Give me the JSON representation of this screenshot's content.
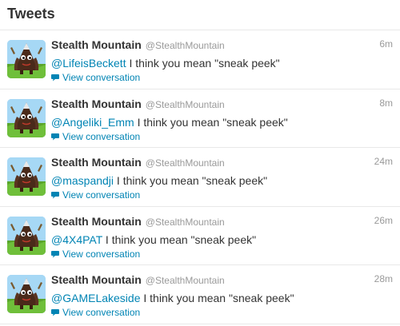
{
  "header": {
    "title": "Tweets"
  },
  "colors": {
    "link": "#0084b4",
    "muted": "#999999",
    "text": "#333333",
    "divider": "#e8e8e8"
  },
  "tweets": [
    {
      "fullname": "Stealth Mountain",
      "username": "@StealthMountain",
      "time": "6m",
      "mention": "@LifeisBeckett",
      "text": " I think you mean \"sneak peek\"",
      "details_label": "View conversation",
      "avatar_icon": "stealth-mountain-avatar"
    },
    {
      "fullname": "Stealth Mountain",
      "username": "@StealthMountain",
      "time": "8m",
      "mention": "@Angeliki_Emm",
      "text": " I think you mean \"sneak peek\"",
      "details_label": "View conversation",
      "avatar_icon": "stealth-mountain-avatar"
    },
    {
      "fullname": "Stealth Mountain",
      "username": "@StealthMountain",
      "time": "24m",
      "mention": "@maspandji",
      "text": " I think you mean \"sneak peek\"",
      "details_label": "View conversation",
      "avatar_icon": "stealth-mountain-avatar"
    },
    {
      "fullname": "Stealth Mountain",
      "username": "@StealthMountain",
      "time": "26m",
      "mention": "@4X4PAT",
      "text": " I think you mean \"sneak peek\"",
      "details_label": "View conversation",
      "avatar_icon": "stealth-mountain-avatar"
    },
    {
      "fullname": "Stealth Mountain",
      "username": "@StealthMountain",
      "time": "28m",
      "mention": "@GAMELakeside",
      "text": " I think you mean \"sneak peek\"",
      "details_label": "View conversation",
      "avatar_icon": "stealth-mountain-avatar"
    }
  ]
}
